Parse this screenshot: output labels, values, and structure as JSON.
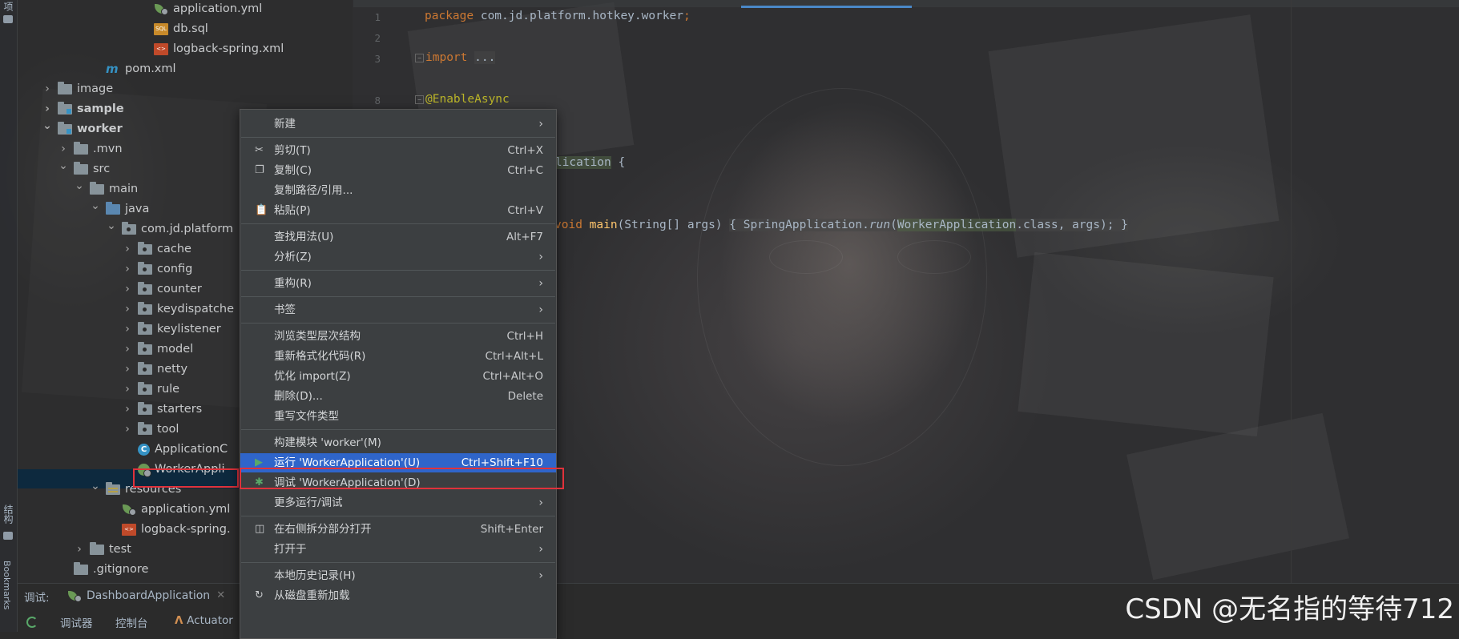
{
  "tool_strip": {
    "top_label": "项",
    "structure_label": "结构",
    "bookmarks_label": "Bookmarks"
  },
  "tree": {
    "items": [
      {
        "label": "application.yml",
        "icon": "spring-config-icon",
        "depth": 7,
        "arrow": "none",
        "bold": false
      },
      {
        "label": "db.sql",
        "icon": "sql-file-icon",
        "depth": 7,
        "arrow": "none",
        "bold": false
      },
      {
        "label": "logback-spring.xml",
        "icon": "xml-file-icon",
        "depth": 7,
        "arrow": "none",
        "bold": false
      },
      {
        "label": "pom.xml",
        "icon": "maven-icon",
        "depth": 4,
        "arrow": "none",
        "bold": false
      },
      {
        "label": "image",
        "icon": "folder-icon",
        "depth": 1,
        "arrow": "right",
        "bold": false
      },
      {
        "label": "sample",
        "icon": "module-folder-icon",
        "depth": 1,
        "arrow": "right",
        "bold": true
      },
      {
        "label": "worker",
        "icon": "module-folder-icon",
        "depth": 1,
        "arrow": "down",
        "bold": true
      },
      {
        "label": ".mvn",
        "icon": "folder-icon",
        "depth": 2,
        "arrow": "right",
        "bold": false
      },
      {
        "label": "src",
        "icon": "folder-icon",
        "depth": 2,
        "arrow": "down",
        "bold": false
      },
      {
        "label": "main",
        "icon": "folder-icon",
        "depth": 3,
        "arrow": "down",
        "bold": false
      },
      {
        "label": "java",
        "icon": "source-folder-icon",
        "depth": 4,
        "arrow": "down",
        "bold": false
      },
      {
        "label": "com.jd.platform",
        "icon": "package-icon",
        "depth": 5,
        "arrow": "down",
        "bold": false
      },
      {
        "label": "cache",
        "icon": "package-icon",
        "depth": 6,
        "arrow": "right",
        "bold": false
      },
      {
        "label": "config",
        "icon": "package-icon",
        "depth": 6,
        "arrow": "right",
        "bold": false
      },
      {
        "label": "counter",
        "icon": "package-icon",
        "depth": 6,
        "arrow": "right",
        "bold": false
      },
      {
        "label": "keydispatche",
        "icon": "package-icon",
        "depth": 6,
        "arrow": "right",
        "bold": false
      },
      {
        "label": "keylistener",
        "icon": "package-icon",
        "depth": 6,
        "arrow": "right",
        "bold": false
      },
      {
        "label": "model",
        "icon": "package-icon",
        "depth": 6,
        "arrow": "right",
        "bold": false
      },
      {
        "label": "netty",
        "icon": "package-icon",
        "depth": 6,
        "arrow": "right",
        "bold": false
      },
      {
        "label": "rule",
        "icon": "package-icon",
        "depth": 6,
        "arrow": "right",
        "bold": false
      },
      {
        "label": "starters",
        "icon": "package-icon",
        "depth": 6,
        "arrow": "right",
        "bold": false
      },
      {
        "label": "tool",
        "icon": "package-icon",
        "depth": 6,
        "arrow": "right",
        "bold": false
      },
      {
        "label": "ApplicationC",
        "icon": "class-icon",
        "depth": 6,
        "arrow": "none",
        "bold": false
      },
      {
        "label": "WorkerAppli",
        "icon": "spring-boot-class-icon",
        "depth": 6,
        "arrow": "none",
        "bold": false
      },
      {
        "label": "resources",
        "icon": "resources-folder-icon",
        "depth": 4,
        "arrow": "down",
        "bold": false
      },
      {
        "label": "application.yml",
        "icon": "spring-config-icon",
        "depth": 5,
        "arrow": "none",
        "bold": false
      },
      {
        "label": "logback-spring.",
        "icon": "xml-file-icon",
        "depth": 5,
        "arrow": "none",
        "bold": false
      },
      {
        "label": "test",
        "icon": "folder-icon",
        "depth": 3,
        "arrow": "right",
        "bold": false
      },
      {
        "label": ".gitignore",
        "icon": "file-icon",
        "depth": 2,
        "arrow": "none",
        "bold": false
      }
    ]
  },
  "editor": {
    "lines": [
      {
        "num": "1",
        "tokens": [
          {
            "t": "package ",
            "c": "kw"
          },
          {
            "t": "com.jd.platform.hotkey.worker",
            "c": ""
          },
          {
            "t": ";",
            "c": "kw"
          }
        ]
      },
      {
        "num": "2",
        "tokens": []
      },
      {
        "num": "3",
        "fold": true,
        "tokens": [
          {
            "t": "import ",
            "c": "kw"
          },
          {
            "t": "...",
            "c": "fold-block"
          }
        ]
      },
      {
        "num": "",
        "tokens": []
      },
      {
        "num": "8",
        "fold": true,
        "tokens": [
          {
            "t": "@EnableAsync",
            "c": "ann"
          }
        ]
      },
      {
        "num": "",
        "tokens": []
      },
      {
        "num": "",
        "tokens": [
          {
            "t": "tion",
            "c": "ann"
          }
        ],
        "offset": true
      },
      {
        "num": "",
        "tokens": [
          {
            "t": "rApplication",
            "c": "hl"
          },
          {
            "t": " {",
            "c": ""
          }
        ],
        "offset": true
      },
      {
        "num": "",
        "tokens": []
      },
      {
        "num": "",
        "tokens": []
      },
      {
        "num": "",
        "tokens": [
          {
            "t": "void ",
            "c": "kw"
          },
          {
            "t": "main",
            "c": "method"
          },
          {
            "t": "(String[] args) ",
            "c": ""
          },
          {
            "t": "{ SpringApplication.",
            "c": "fold-block"
          },
          {
            "t": "run",
            "c": "fold-block italic"
          },
          {
            "t": "(",
            "c": "fold-block"
          },
          {
            "t": "WorkerApplication",
            "c": "hl"
          },
          {
            "t": ".class, args); }",
            "c": "fold-block"
          }
        ],
        "offset": true
      }
    ]
  },
  "context_menu": {
    "items": [
      {
        "label": "新建",
        "shortcut": "",
        "submenu": true,
        "icon": ""
      },
      {
        "sep": true
      },
      {
        "label": "剪切(T)",
        "shortcut": "Ctrl+X",
        "submenu": false,
        "icon": "cut-icon"
      },
      {
        "label": "复制(C)",
        "shortcut": "Ctrl+C",
        "submenu": false,
        "icon": "copy-icon"
      },
      {
        "label": "复制路径/引用...",
        "shortcut": "",
        "submenu": false,
        "icon": ""
      },
      {
        "label": "粘贴(P)",
        "shortcut": "Ctrl+V",
        "submenu": false,
        "icon": "paste-icon"
      },
      {
        "sep": true
      },
      {
        "label": "查找用法(U)",
        "shortcut": "Alt+F7",
        "submenu": false,
        "icon": ""
      },
      {
        "label": "分析(Z)",
        "shortcut": "",
        "submenu": true,
        "icon": ""
      },
      {
        "sep": true
      },
      {
        "label": "重构(R)",
        "shortcut": "",
        "submenu": true,
        "icon": ""
      },
      {
        "sep": true
      },
      {
        "label": "书签",
        "shortcut": "",
        "submenu": true,
        "icon": ""
      },
      {
        "sep": true
      },
      {
        "label": "浏览类型层次结构",
        "shortcut": "Ctrl+H",
        "submenu": false,
        "icon": ""
      },
      {
        "label": "重新格式化代码(R)",
        "shortcut": "Ctrl+Alt+L",
        "submenu": false,
        "icon": ""
      },
      {
        "label": "优化 import(Z)",
        "shortcut": "Ctrl+Alt+O",
        "submenu": false,
        "icon": ""
      },
      {
        "label": "删除(D)...",
        "shortcut": "Delete",
        "submenu": false,
        "icon": ""
      },
      {
        "label": "重写文件类型",
        "shortcut": "",
        "submenu": false,
        "icon": ""
      },
      {
        "sep": true
      },
      {
        "label": "构建模块 'worker'(M)",
        "shortcut": "",
        "submenu": false,
        "icon": ""
      },
      {
        "label": "运行 'WorkerApplication'(U)",
        "shortcut": "Ctrl+Shift+F10",
        "submenu": false,
        "icon": "run-icon",
        "active": true
      },
      {
        "label": "调试 'WorkerApplication'(D)",
        "shortcut": "",
        "submenu": false,
        "icon": "debug-icon"
      },
      {
        "label": "更多运行/调试",
        "shortcut": "",
        "submenu": true,
        "icon": ""
      },
      {
        "sep": true
      },
      {
        "label": "在右侧拆分部分打开",
        "shortcut": "Shift+Enter",
        "submenu": false,
        "icon": "split-icon"
      },
      {
        "label": "打开于",
        "shortcut": "",
        "submenu": true,
        "icon": ""
      },
      {
        "sep": true
      },
      {
        "label": "本地历史记录(H)",
        "shortcut": "",
        "submenu": true,
        "icon": ""
      },
      {
        "label": "从磁盘重新加载",
        "shortcut": "",
        "submenu": false,
        "icon": "reload-icon"
      }
    ]
  },
  "bottom": {
    "debug_label": "调试:",
    "run_config": "DashboardApplication",
    "tools": [
      "调试器",
      "控制台",
      "Actuator"
    ]
  },
  "watermark": "CSDN @无名指的等待712",
  "colors": {
    "accent": "#2f65ca",
    "highlight_box": "#e0323b",
    "selection": "#0d293e"
  }
}
